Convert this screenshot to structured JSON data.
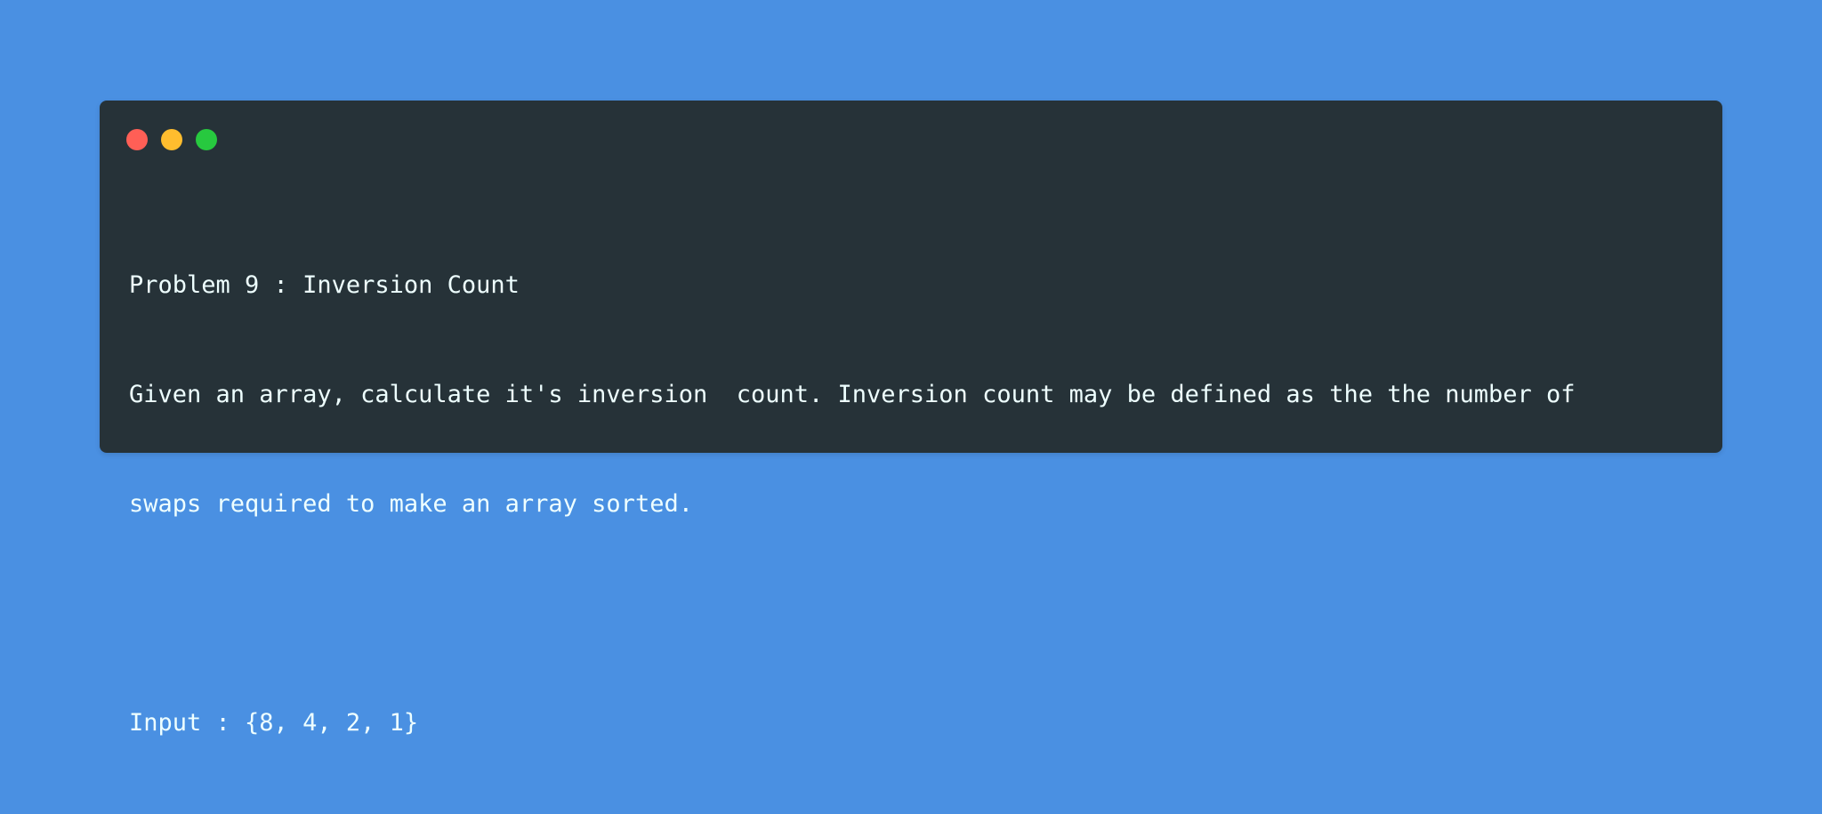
{
  "window": {
    "buttons": [
      {
        "name": "close",
        "color": "#ff5f56"
      },
      {
        "name": "minimize",
        "color": "#ffbd2e"
      },
      {
        "name": "zoom",
        "color": "#27c93f"
      }
    ]
  },
  "code": {
    "lines": [
      "Problem 9 : Inversion Count",
      "Given an array, calculate it's inversion  count. Inversion count may be defined as the the number of",
      "swaps required to make an array sorted.",
      "",
      "Input : {8, 4, 2, 1}"
    ]
  }
}
